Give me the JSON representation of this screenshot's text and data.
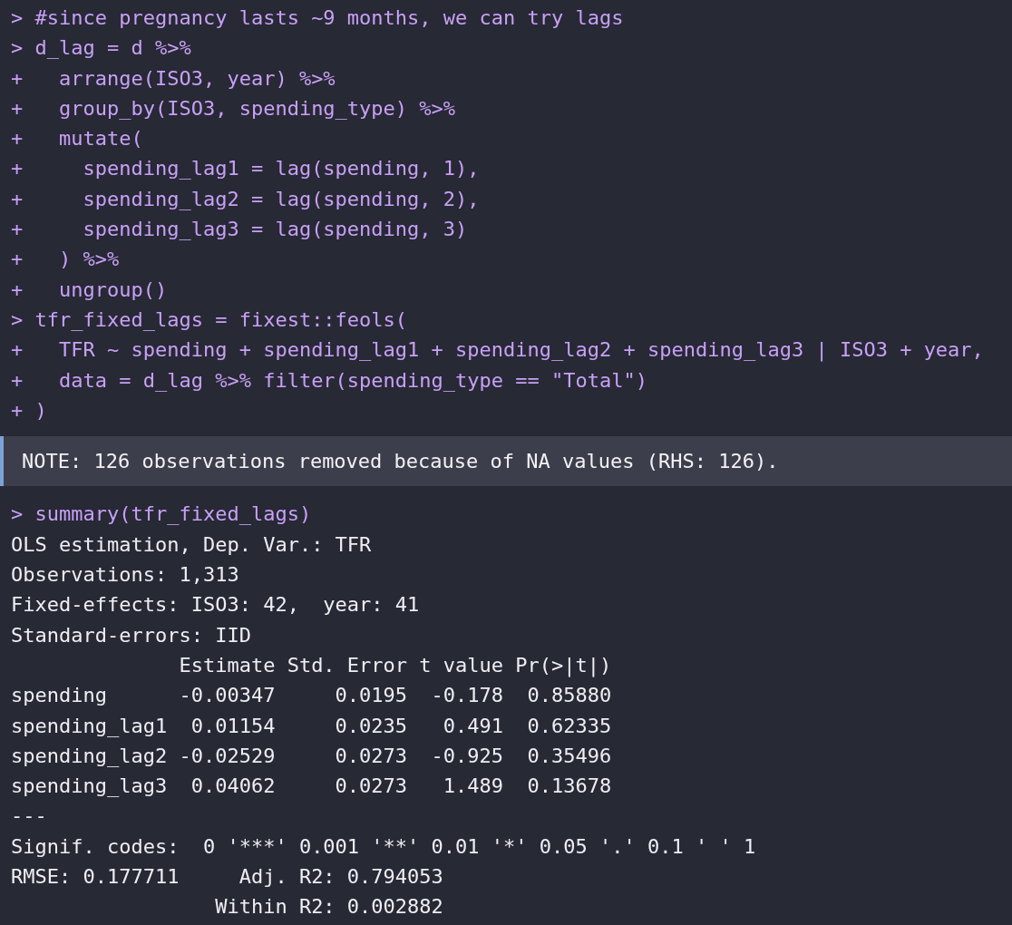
{
  "console": {
    "blocks": [
      {
        "kind": "input",
        "lines": [
          "> #since pregnancy lasts ~9 months, we can try lags",
          "> d_lag = d %>%",
          "+   arrange(ISO3, year) %>%",
          "+   group_by(ISO3, spending_type) %>%",
          "+   mutate(",
          "+     spending_lag1 = lag(spending, 1),",
          "+     spending_lag2 = lag(spending, 2),",
          "+     spending_lag3 = lag(spending, 3)",
          "+   ) %>%",
          "+   ungroup()",
          "> tfr_fixed_lags = fixest::feols(",
          "+   TFR ~ spending + spending_lag1 + spending_lag2 + spending_lag3 | ISO3 + year,",
          "+   data = d_lag %>% filter(spending_type == \"Total\")",
          "+ )"
        ]
      },
      {
        "kind": "message",
        "lines": [
          "NOTE: 126 observations removed because of NA values (RHS: 126)."
        ]
      },
      {
        "kind": "input",
        "lines": [
          "> summary(tfr_fixed_lags)"
        ]
      },
      {
        "kind": "output",
        "lines": [
          "OLS estimation, Dep. Var.: TFR",
          "Observations: 1,313",
          "Fixed-effects: ISO3: 42,  year: 41",
          "Standard-errors: IID",
          "              Estimate Std. Error t value Pr(>|t|)",
          "spending      -0.00347     0.0195  -0.178  0.85880",
          "spending_lag1  0.01154     0.0235   0.491  0.62335",
          "spending_lag2 -0.02529     0.0273  -0.925  0.35496",
          "spending_lag3  0.04062     0.0273   1.489  0.13678",
          "---",
          "Signif. codes:  0 '***' 0.001 '**' 0.01 '*' 0.05 '.' 0.1 ' ' 1",
          "RMSE: 0.177711     Adj. R2: 0.794053",
          "                 Within R2: 0.002882"
        ]
      }
    ]
  }
}
